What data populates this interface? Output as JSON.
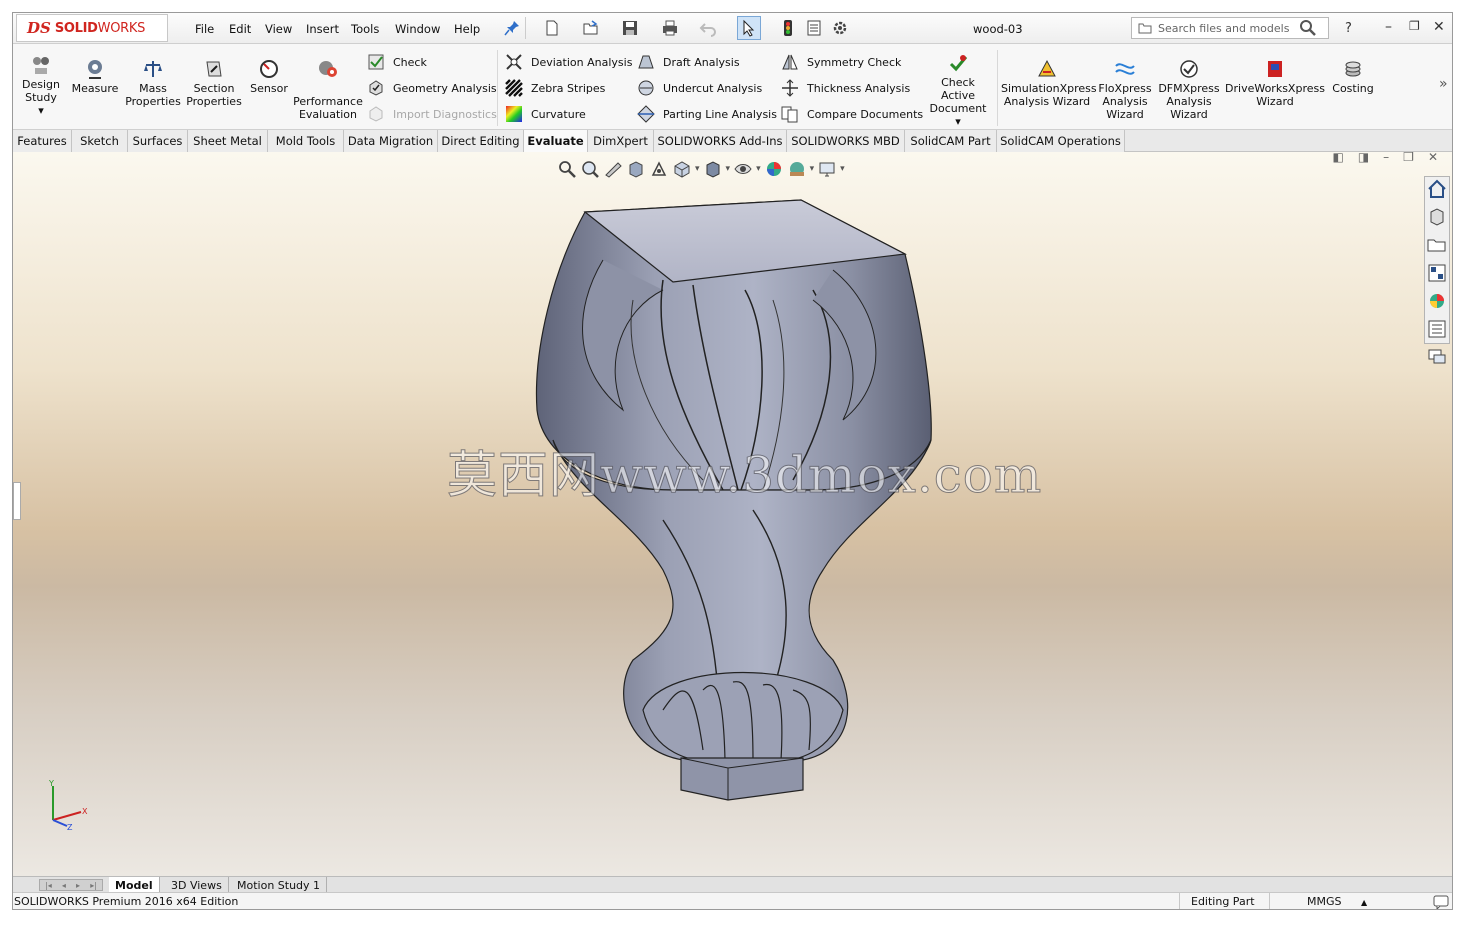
{
  "app": {
    "brand_ds": "DS",
    "brand_solid": "SOLID",
    "brand_works": "WORKS",
    "document_title": "wood-03",
    "search_placeholder": "Search files and models",
    "help": "?",
    "menus": [
      "File",
      "Edit",
      "View",
      "Insert",
      "Tools",
      "Window",
      "Help"
    ]
  },
  "commands": {
    "design_study": [
      "Design",
      "Study"
    ],
    "measure": "Measure",
    "mass_properties": [
      "Mass",
      "Properties"
    ],
    "section_properties": [
      "Section",
      "Properties"
    ],
    "sensor": "Sensor",
    "performance_evaluation": [
      "Performance",
      "Evaluation"
    ],
    "check": "Check",
    "geometry_analysis": "Geometry Analysis",
    "import_diagnostics": "Import Diagnostics",
    "deviation_analysis": "Deviation Analysis",
    "zebra_stripes": "Zebra Stripes",
    "curvature": "Curvature",
    "draft_analysis": "Draft Analysis",
    "undercut_analysis": "Undercut Analysis",
    "parting_line_analysis": "Parting Line Analysis",
    "symmetry_check": "Symmetry Check",
    "thickness_analysis": "Thickness Analysis",
    "compare_documents": "Compare Documents",
    "check_active_document": [
      "Check Active",
      "Document"
    ],
    "simulationxpress": [
      "SimulationXpress",
      "Analysis Wizard"
    ],
    "floxpress": [
      "FloXpress",
      "Analysis",
      "Wizard"
    ],
    "dfmxpress": [
      "DFMXpress",
      "Analysis",
      "Wizard"
    ],
    "driveworksxpress": [
      "DriveWorksXpress",
      "Wizard"
    ],
    "costing": "Costing",
    "more": "»"
  },
  "tabs": [
    "Features",
    "Sketch",
    "Surfaces",
    "Sheet Metal",
    "Mold Tools",
    "Data Migration",
    "Direct Editing",
    "Evaluate",
    "DimXpert",
    "SOLIDWORKS Add-Ins",
    "SOLIDWORKS MBD",
    "SolidCAM Part",
    "SolidCAM Operations"
  ],
  "active_tab": "Evaluate",
  "viewport": {
    "watermark": "莫西网www.3dmox.com",
    "triad_x": "X",
    "triad_y": "Y",
    "triad_z": "Z"
  },
  "bottom_tabs": [
    "Model",
    "3D Views",
    "Motion Study 1"
  ],
  "status": {
    "edition": "SOLIDWORKS Premium 2016 x64 Edition",
    "mode": "Editing Part",
    "units": "MMGS",
    "units_arrow": "▲"
  },
  "colors": {
    "brand_red": "#d0251f",
    "model_gray": "#8c90a4",
    "background_top": "#fbf8ef",
    "background_mid": "#d7c1a3"
  }
}
